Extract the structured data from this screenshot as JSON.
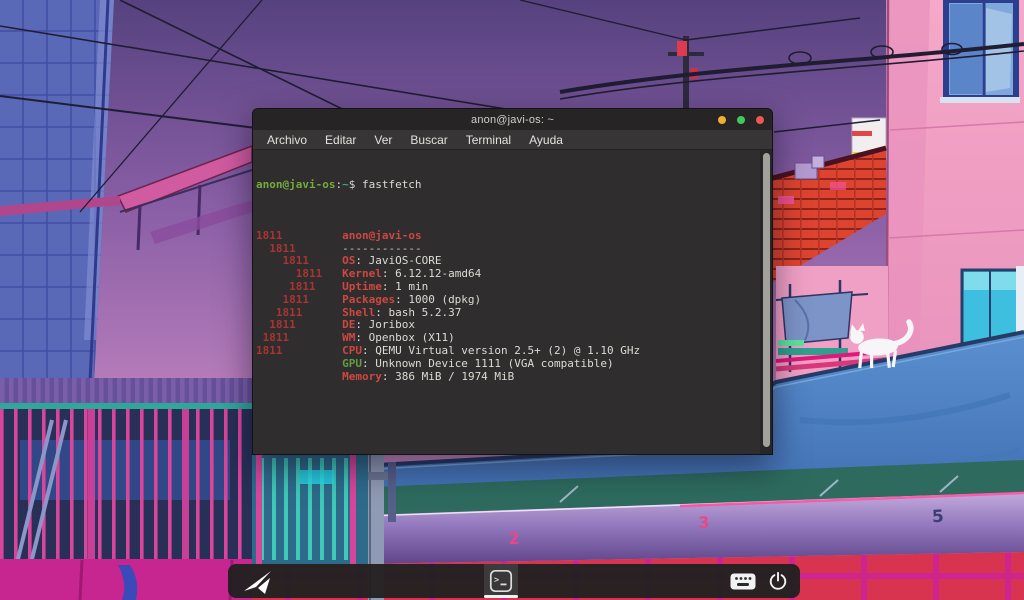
{
  "window": {
    "title": "anon@javi-os: ~",
    "menu": [
      "Archivo",
      "Editar",
      "Ver",
      "Buscar",
      "Terminal",
      "Ayuda"
    ],
    "control_colors": {
      "minimize": "#efb02e",
      "maximize": "#3fc95d",
      "close": "#ef5850"
    }
  },
  "terminal": {
    "prompt": {
      "user": "anon@javi-os",
      "colon": ":",
      "path": "~",
      "dollar": "$"
    },
    "command": "fastfetch",
    "fastfetch": {
      "lines": [
        {
          "indent": 0,
          "logo": "1811",
          "key": "anon@javi-os",
          "sep": "",
          "value": "",
          "style": "title"
        },
        {
          "indent": 2,
          "logo": "1811",
          "key": "",
          "sep": "",
          "value": "------------",
          "style": "dash"
        },
        {
          "indent": 4,
          "logo": "1811",
          "key": "OS",
          "sep": ": ",
          "value": "JaviOS-CORE",
          "style": "key"
        },
        {
          "indent": 6,
          "logo": "1811",
          "key": "Kernel",
          "sep": ": ",
          "value": "6.12.12-amd64",
          "style": "key"
        },
        {
          "indent": 5,
          "logo": "1811",
          "key": "Uptime",
          "sep": ": ",
          "value": "1 min",
          "style": "key"
        },
        {
          "indent": 4,
          "logo": "1811",
          "key": "Packages",
          "sep": ": ",
          "value": "1000 (dpkg)",
          "style": "key"
        },
        {
          "indent": 3,
          "logo": "1811",
          "key": "Shell",
          "sep": ": ",
          "value": "bash 5.2.37",
          "style": "key"
        },
        {
          "indent": 2,
          "logo": "1811",
          "key": "DE",
          "sep": ": ",
          "value": "Joribox",
          "style": "key"
        },
        {
          "indent": 1,
          "logo": "1811",
          "key": "WM",
          "sep": ": ",
          "value": "Openbox (X11)",
          "style": "key"
        },
        {
          "indent": 0,
          "logo": "1811",
          "key": "CPU",
          "sep": ": ",
          "value": "QEMU Virtual version 2.5+ (2) @ 1.10 GHz",
          "style": "key"
        },
        {
          "indent": 0,
          "logo": "",
          "key": "GPU",
          "sep": ": ",
          "value": "Unknown Device 1111 (VGA compatible)",
          "style": "key-green"
        },
        {
          "indent": 0,
          "logo": "",
          "key": "Memory",
          "sep": ": ",
          "value": "386 MiB / 1974 MiB",
          "style": "key"
        }
      ],
      "palette_normal": [
        "#2e3436",
        "#cc0000",
        "#4e9a06",
        "#c4a000",
        "#3465a4",
        "#75507b",
        "#06989a",
        "#d3d7cf"
      ],
      "palette_bright": [
        "#555753",
        "#ef2929",
        "#8ae234",
        "#fce94f",
        "#729fcf",
        "#ad7fa8",
        "#34e2e2",
        "#eeeeec"
      ]
    }
  },
  "wallpaper": {
    "numbers": {
      "n2": "2",
      "n3": "3",
      "n5": "5"
    }
  },
  "colors": {
    "prompt_green": "#74ab3c",
    "logo_red": "#a93434",
    "key_red": "#cd4840"
  }
}
